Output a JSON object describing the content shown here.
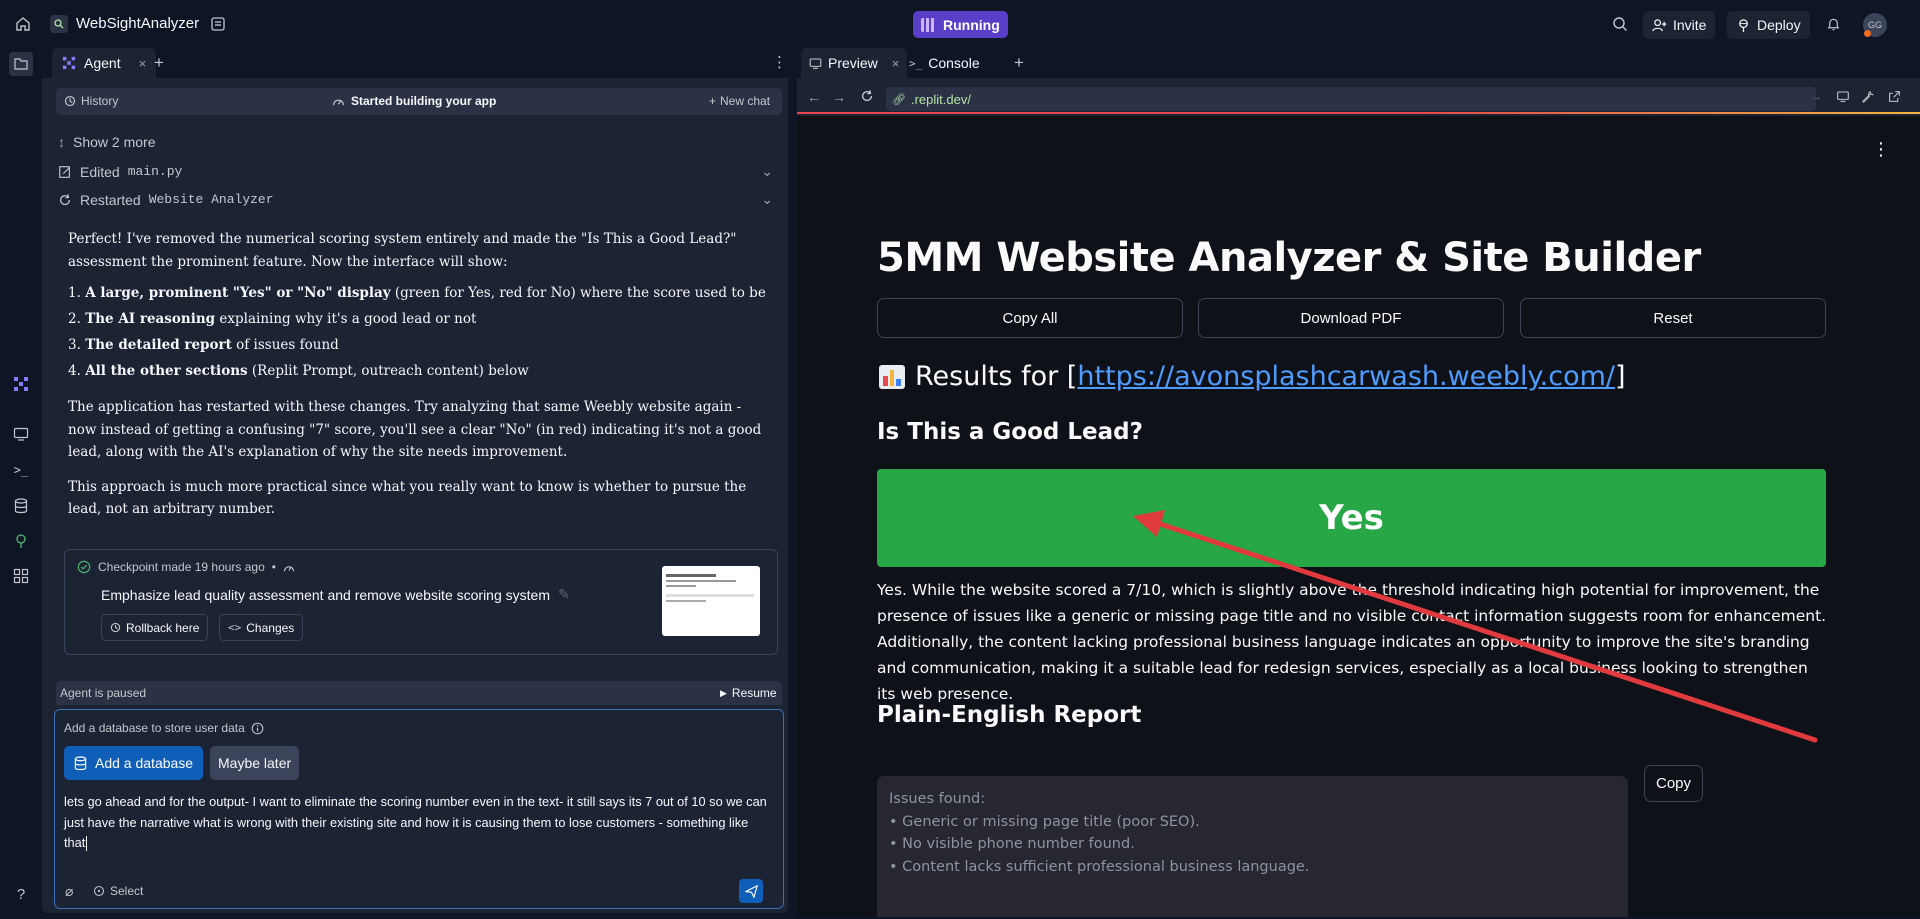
{
  "topbar": {
    "app_name": "WebSightAnalyzer",
    "status": "Running",
    "invite_label": "Invite",
    "deploy_label": "Deploy",
    "avatar_initials": "GG",
    "accent": "#5b3ec8"
  },
  "agent": {
    "tab_label": "Agent",
    "history_label": "History",
    "history_title": "Started building your app",
    "new_chat_label": "New chat",
    "show_more": "Show 2 more",
    "edited_prefix": "Edited",
    "edited_file": "main.py",
    "restarted_prefix": "Restarted",
    "restarted_name": "Website Analyzer",
    "message": {
      "intro": "Perfect! I've removed the numerical scoring system entirely and made the \"Is This a Good Lead?\" assessment the prominent feature. Now the interface will show:",
      "items": [
        {
          "num": "1.",
          "bold": "A large, prominent \"Yes\" or \"No\" display",
          "rest": " (green for Yes, red for No) where the score used to be"
        },
        {
          "num": "2.",
          "bold": "The AI reasoning",
          "rest": " explaining why it's a good lead or not"
        },
        {
          "num": "3.",
          "bold": "The detailed report",
          "rest": " of issues found"
        },
        {
          "num": "4.",
          "bold": "All the other sections",
          "rest": " (Replit Prompt, outreach content) below"
        }
      ],
      "para2": "The application has restarted with these changes. Try analyzing that same Weebly website again - now instead of getting a confusing \"7\" score, you'll see a clear \"No\" (in red) indicating it's not a good lead, along with the AI's explanation of why the site needs improvement.",
      "para3": "This approach is much more practical since what you really want to know is whether to pursue the lead, not an arbitrary number."
    },
    "checkpoint": {
      "made": "Checkpoint made 19 hours ago",
      "dot": "•",
      "description": "Emphasize lead quality assessment and remove website scoring system",
      "rollback_label": "Rollback here",
      "changes_label": "Changes"
    },
    "paused_label": "Agent is paused",
    "resume_label": "Resume",
    "composer": {
      "db_prompt": "Add a database to store user data",
      "add_db_label": "Add a database",
      "maybe_later_label": "Maybe later",
      "input_text": "lets go ahead and for the output- I want to eliminate the scoring number even in the text- it still says its 7 out of 10 so we can just have the narrative what is wrong with their existing site and how it is causing them to lose customers - something like that",
      "select_label": "Select"
    }
  },
  "preview": {
    "tab_preview": "Preview",
    "tab_console": "Console",
    "url": ".replit.dev/",
    "page": {
      "title": "5MM Website Analyzer & Site Builder",
      "buttons": [
        "Copy All",
        "Download PDF",
        "Reset"
      ],
      "results_prefix": "Results for [",
      "results_link": "https://avonsplashcarwash.weebly.com/",
      "results_suffix": "]",
      "lead_heading": "Is This a Good Lead?",
      "lead_answer": "Yes",
      "lead_color": "#27a745",
      "reason": "Yes. While the website scored a 7/10, which is slightly above the threshold indicating high potential for improvement, the presence of issues like a generic or missing page title and no visible contact information suggests room for enhancement. Additionally, the content lacking professional business language indicates an opportunity to improve the site's branding and communication, making it a suitable lead for redesign services, especially as a local business looking to strengthen its web presence.",
      "report_heading": "Plain-English Report",
      "copy_label": "Copy",
      "issues": [
        "Issues found:",
        "• Generic or missing page title (poor SEO).",
        "• No visible phone number found.",
        "• Content lacks sufficient professional business language."
      ]
    }
  }
}
